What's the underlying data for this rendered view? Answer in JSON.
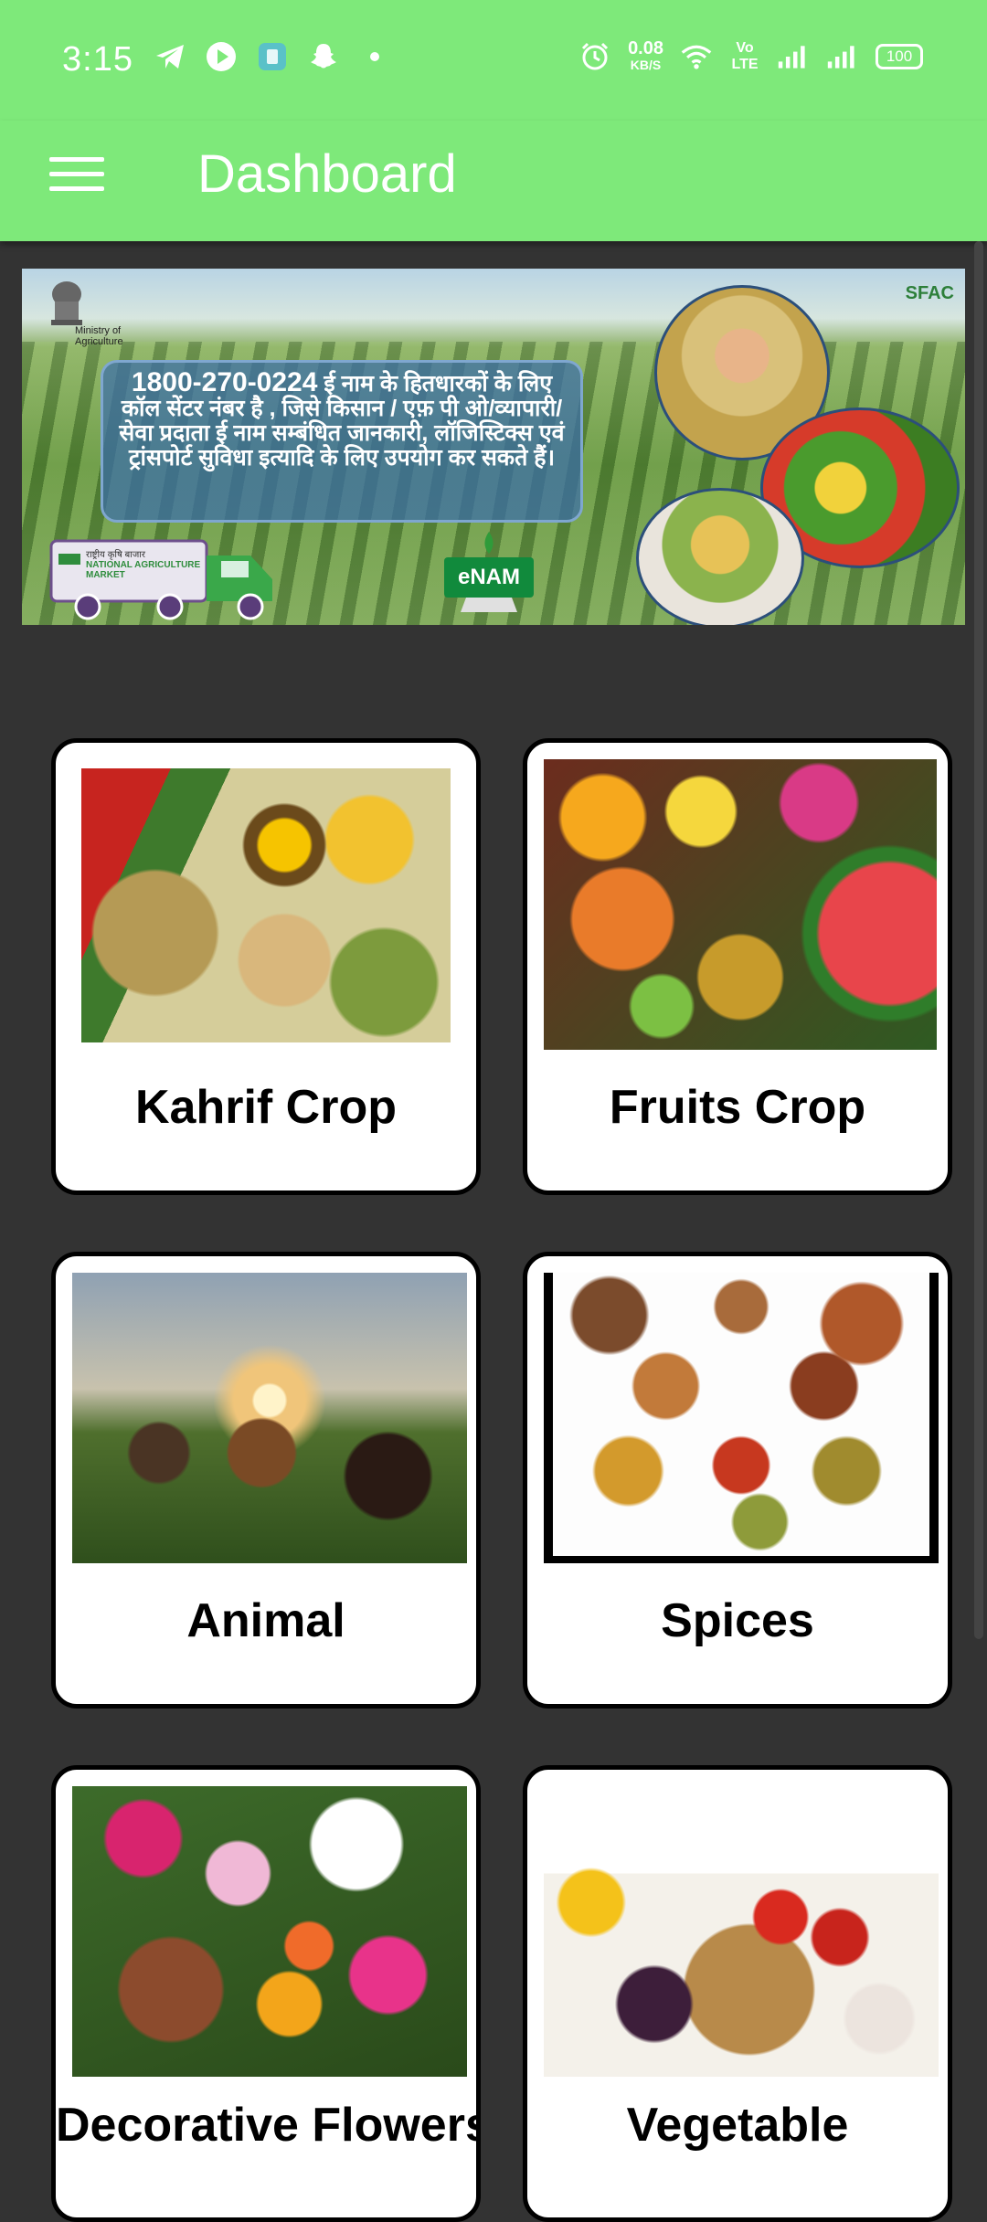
{
  "status_bar": {
    "time": "3:15",
    "net_speed_value": "0.08",
    "net_speed_unit": "KB/S",
    "volte": "Vo LTE",
    "battery": "100",
    "left_icons": [
      "telegram-icon",
      "play-icon",
      "app-icon",
      "snapchat-icon",
      "dot-icon"
    ],
    "right_icons": [
      "alarm-icon",
      "wifi-icon",
      "signal-icon",
      "signal-icon"
    ]
  },
  "app_bar": {
    "title": "Dashboard",
    "color": "#7ee97a"
  },
  "banner": {
    "ministry": "Ministry of Agriculture",
    "helpline_number": "1800-270-0224",
    "helpline_text": "ई नाम के हितधारकों के लिए कॉल सेंटर नंबर है , जिसे किसान / एफ़ पी ओ/व्यापारी/सेवा प्रदाता ई नाम सम्बंधित जानकारी, लॉजिस्टिक्स एवं ट्रांसपोर्ट सुविधा इत्यादि के लिए उपयोग कर सकते हैं।",
    "enam_logo": "eNAM",
    "sfac_logo": "SFAC",
    "truck_text": "राष्ट्रीय कृषि बाजार",
    "truck_subtext": "NATIONAL AGRICULTURE MARKET"
  },
  "categories": [
    {
      "label": "Kahrif Crop"
    },
    {
      "label": "Fruits Crop"
    },
    {
      "label": "Animal"
    },
    {
      "label": "Spices"
    },
    {
      "label": "Decorative Flowers"
    },
    {
      "label": "Vegetable"
    }
  ]
}
